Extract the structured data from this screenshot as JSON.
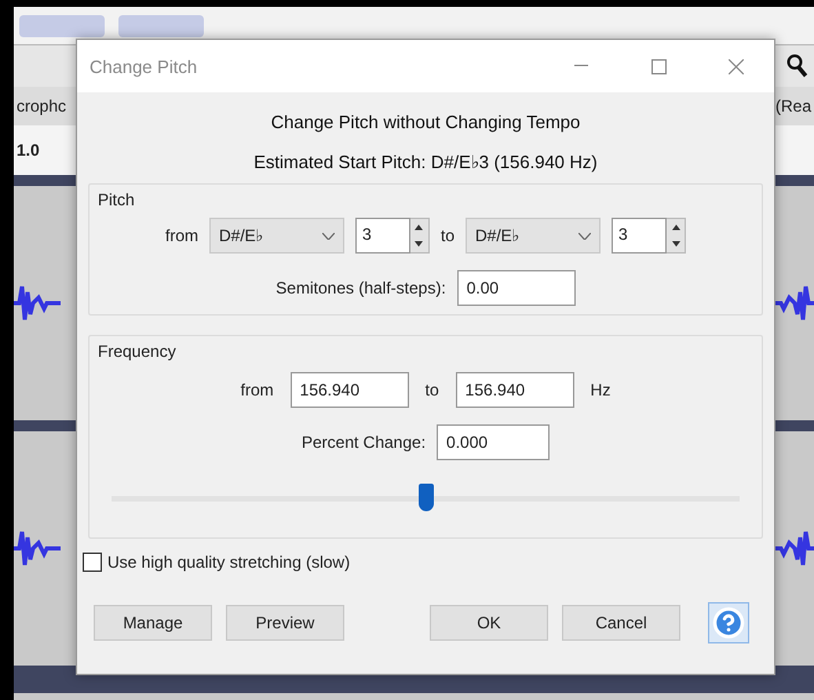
{
  "background": {
    "track_name": "crophc",
    "scale_label": "1.0",
    "right_label": "(Rea"
  },
  "dialog": {
    "title": "Change Pitch",
    "heading": "Change Pitch without Changing Tempo",
    "estimate": "Estimated Start Pitch: D#/E♭3 (156.940 Hz)",
    "pitch": {
      "label": "Pitch",
      "from_label": "from",
      "from_note": "D#/E♭",
      "from_octave": "3",
      "to_label": "to",
      "to_note": "D#/E♭",
      "to_octave": "3",
      "semitones_label": "Semitones (half-steps):",
      "semitones": "0.00"
    },
    "frequency": {
      "label": "Frequency",
      "from_label": "from",
      "from": "156.940",
      "to_label": "to",
      "to": "156.940",
      "unit": "Hz",
      "percent_label": "Percent Change:",
      "percent": "0.000",
      "slider": {
        "level": 0.5
      }
    },
    "high_quality": {
      "label": "Use high quality stretching (slow)",
      "checked": false
    },
    "buttons": [
      {
        "label": "Manage",
        "kind": "left"
      },
      {
        "label": "Preview",
        "kind": "left"
      },
      {
        "label": "OK",
        "kind": "right"
      },
      {
        "label": "Cancel",
        "kind": "right"
      },
      {
        "kind": "help"
      }
    ]
  }
}
